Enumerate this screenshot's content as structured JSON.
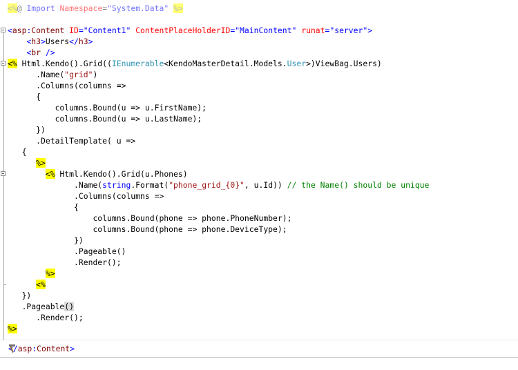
{
  "lines": [
    {
      "segs": [
        {
          "t": "<%",
          "c": "sd-dim t-gray"
        },
        {
          "t": "@ ",
          "c": "t-gray"
        },
        {
          "t": "Import",
          "c": "t-dir"
        },
        {
          "t": " ",
          "c": ""
        },
        {
          "t": "Namespace",
          "c": "t-ns"
        },
        {
          "t": "=",
          "c": "t-gray"
        },
        {
          "t": "\"System.Data\"",
          "c": "t-nv"
        },
        {
          "t": " ",
          "c": ""
        },
        {
          "t": "%>",
          "c": "sd-dim t-gray"
        }
      ]
    },
    {
      "segs": [
        {
          "t": "",
          "c": ""
        }
      ]
    },
    {
      "segs": [
        {
          "t": "<",
          "c": "t-kw"
        },
        {
          "t": "asp",
          "c": "t-ht"
        },
        {
          "t": ":",
          "c": "t-kw"
        },
        {
          "t": "Content",
          "c": "t-ht"
        },
        {
          "t": " ",
          "c": ""
        },
        {
          "t": "ID",
          "c": "t-at"
        },
        {
          "t": "=",
          "c": "t-kw"
        },
        {
          "t": "\"Content1\"",
          "c": "t-st"
        },
        {
          "t": " ",
          "c": ""
        },
        {
          "t": "ContentPlaceHolderID",
          "c": "t-at"
        },
        {
          "t": "=",
          "c": "t-kw"
        },
        {
          "t": "\"MainContent\"",
          "c": "t-st"
        },
        {
          "t": " ",
          "c": ""
        },
        {
          "t": "runat",
          "c": "t-at"
        },
        {
          "t": "=",
          "c": "t-kw"
        },
        {
          "t": "\"server\"",
          "c": "t-st"
        },
        {
          "t": ">",
          "c": "t-kw"
        }
      ]
    },
    {
      "segs": [
        {
          "t": "    ",
          "c": ""
        },
        {
          "t": "<",
          "c": "t-kw"
        },
        {
          "t": "h3",
          "c": "t-ht"
        },
        {
          "t": ">",
          "c": "t-kw"
        },
        {
          "t": "Users",
          "c": ""
        },
        {
          "t": "</",
          "c": "t-kw"
        },
        {
          "t": "h3",
          "c": "t-ht"
        },
        {
          "t": ">",
          "c": "t-kw"
        }
      ]
    },
    {
      "segs": [
        {
          "t": "    ",
          "c": ""
        },
        {
          "t": "<",
          "c": "t-kw"
        },
        {
          "t": "br",
          "c": "t-ht"
        },
        {
          "t": " />",
          "c": "t-kw"
        }
      ]
    },
    {
      "segs": [
        {
          "t": "<%",
          "c": "sd"
        },
        {
          "t": " Html.Kendo().Grid((",
          "c": ""
        },
        {
          "t": "IEnumerable",
          "c": "t-ty"
        },
        {
          "t": "<KendoMasterDetail.Models.",
          "c": ""
        },
        {
          "t": "User",
          "c": "t-ty"
        },
        {
          "t": ">)ViewBag.Users)",
          "c": ""
        }
      ]
    },
    {
      "segs": [
        {
          "t": "      .Name(",
          "c": ""
        },
        {
          "t": "\"grid\"",
          "c": "t-cs"
        },
        {
          "t": ")",
          "c": ""
        }
      ]
    },
    {
      "segs": [
        {
          "t": "      .Columns(columns =>",
          "c": ""
        }
      ]
    },
    {
      "segs": [
        {
          "t": "      {",
          "c": ""
        }
      ]
    },
    {
      "segs": [
        {
          "t": "          columns.Bound(u => u.FirstName);",
          "c": ""
        }
      ]
    },
    {
      "segs": [
        {
          "t": "          columns.Bound(u => u.LastName);",
          "c": ""
        }
      ]
    },
    {
      "segs": [
        {
          "t": "      })",
          "c": ""
        }
      ]
    },
    {
      "segs": [
        {
          "t": "      .DetailTemplate( u =>",
          "c": ""
        }
      ]
    },
    {
      "segs": [
        {
          "t": "   {",
          "c": ""
        }
      ]
    },
    {
      "segs": [
        {
          "t": "      ",
          "c": ""
        },
        {
          "t": "%>",
          "c": "sd"
        }
      ]
    },
    {
      "segs": [
        {
          "t": "        ",
          "c": ""
        },
        {
          "t": "<%",
          "c": "sd"
        },
        {
          "t": " Html.Kendo().Grid(u.Phones)",
          "c": ""
        }
      ]
    },
    {
      "segs": [
        {
          "t": "              .Name(",
          "c": ""
        },
        {
          "t": "string",
          "c": "t-kw"
        },
        {
          "t": ".Format(",
          "c": ""
        },
        {
          "t": "\"phone_grid_{0}\"",
          "c": "t-cs"
        },
        {
          "t": ", u.Id)) ",
          "c": ""
        },
        {
          "t": "// the Name() should be unique",
          "c": "t-cm"
        }
      ]
    },
    {
      "segs": [
        {
          "t": "              .Columns(columns =>",
          "c": ""
        }
      ]
    },
    {
      "segs": [
        {
          "t": "              {",
          "c": ""
        }
      ]
    },
    {
      "segs": [
        {
          "t": "                  columns.Bound(phone => phone.PhoneNumber);",
          "c": ""
        }
      ]
    },
    {
      "segs": [
        {
          "t": "                  columns.Bound(phone => phone.DeviceType);",
          "c": ""
        }
      ]
    },
    {
      "segs": [
        {
          "t": "              })",
          "c": ""
        }
      ]
    },
    {
      "segs": [
        {
          "t": "              .Pageable()",
          "c": ""
        }
      ]
    },
    {
      "segs": [
        {
          "t": "              .Render();",
          "c": ""
        }
      ]
    },
    {
      "segs": [
        {
          "t": "        ",
          "c": ""
        },
        {
          "t": "%>",
          "c": "sd"
        }
      ]
    },
    {
      "segs": [
        {
          "t": "      ",
          "c": ""
        },
        {
          "t": "<%",
          "c": "sd"
        }
      ]
    },
    {
      "segs": [
        {
          "t": "   })",
          "c": ""
        }
      ]
    },
    {
      "segs": [
        {
          "t": "   .Pageable",
          "c": ""
        },
        {
          "t": "()",
          "c": "paren-hl"
        }
      ]
    },
    {
      "segs": [
        {
          "t": "      .Render();",
          "c": ""
        }
      ]
    },
    {
      "segs": [
        {
          "t": "%>",
          "c": "sd"
        }
      ]
    }
  ],
  "breadcrumb": {
    "segs": [
      {
        "t": "</",
        "c": "t-kw"
      },
      {
        "t": "asp",
        "c": "t-ht"
      },
      {
        "t": ":",
        "c": "t-kw"
      },
      {
        "t": "Content",
        "c": "t-ht"
      },
      {
        "t": ">",
        "c": "t-kw"
      }
    ]
  },
  "icons": {
    "hammer": "hammer-icon"
  }
}
